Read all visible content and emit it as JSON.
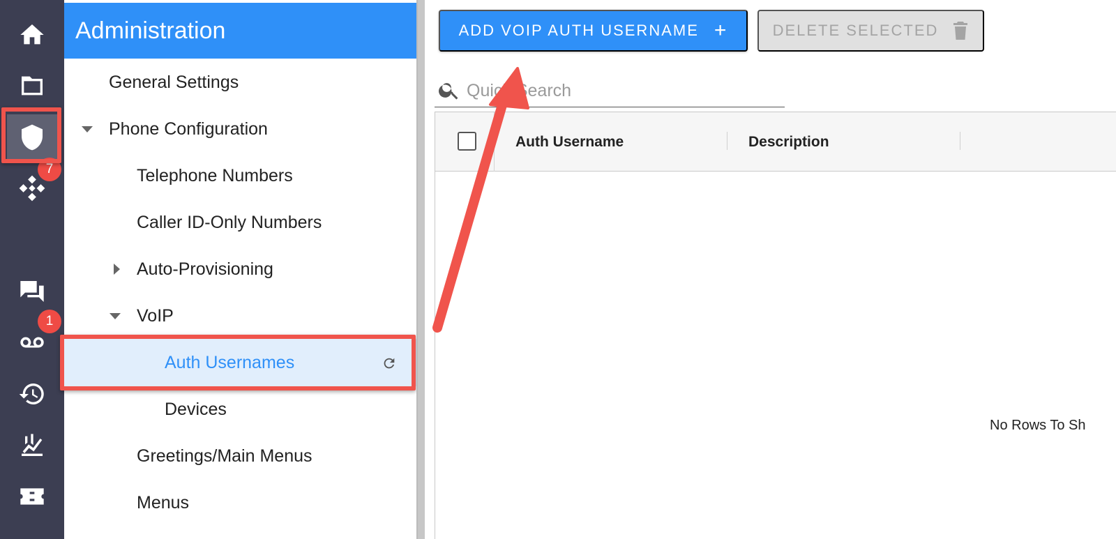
{
  "rail": {
    "items": [
      {
        "icon": "home-icon"
      },
      {
        "icon": "folder-icon"
      },
      {
        "icon": "shield-icon",
        "active": true
      },
      {
        "icon": "network-icon",
        "badge": "7"
      },
      {
        "icon": "chat-icon"
      },
      {
        "icon": "voicemail-icon",
        "badge": "1"
      },
      {
        "icon": "history-icon"
      },
      {
        "icon": "analytics-icon"
      },
      {
        "icon": "ticket-icon"
      }
    ],
    "network_badge": "7",
    "voicemail_badge": "1"
  },
  "nav": {
    "title": "Administration",
    "items": {
      "general_settings": "General Settings",
      "phone_configuration": "Phone Configuration",
      "telephone_numbers": "Telephone Numbers",
      "caller_id_only_numbers": "Caller ID-Only Numbers",
      "auto_provisioning": "Auto-Provisioning",
      "voip": "VoIP",
      "auth_usernames": "Auth Usernames",
      "devices": "Devices",
      "greetings_main_menus": "Greetings/Main Menus",
      "menus": "Menus"
    },
    "selected": "Auth Usernames"
  },
  "toolbar": {
    "add_label": "ADD VOIP AUTH USERNAME",
    "add_icon": "+",
    "delete_label": "DELETE SELECTED"
  },
  "search": {
    "placeholder": "Quick Search"
  },
  "grid": {
    "columns": [
      "Auth Username",
      "Description"
    ],
    "empty_message": "No Rows To Sh"
  },
  "colors": {
    "rail_bg": "#3c3e52",
    "accent": "#2f90f8",
    "badge": "#ef4b45",
    "annotation": "#f0544c",
    "selected_bg": "#e1eefc"
  }
}
